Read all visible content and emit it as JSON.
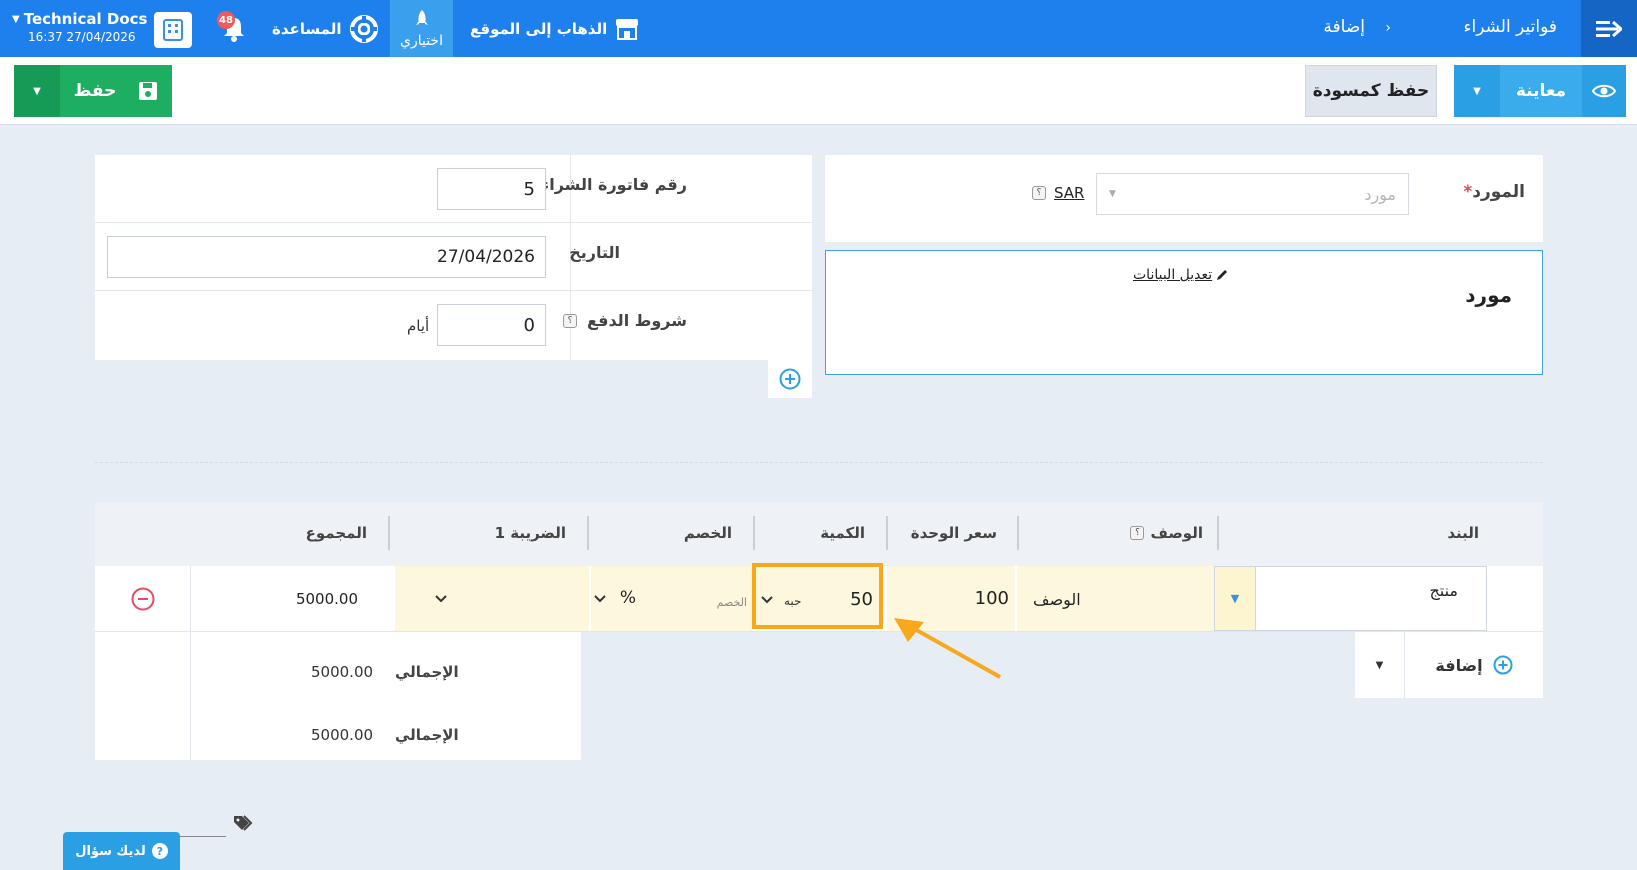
{
  "topbar": {
    "breadcrumb_root": "فواتير الشراء",
    "breadcrumb_current": "إضافة",
    "goto_site": "الذهاب إلى الموقع",
    "my_choice": "اختياري",
    "help": "المساعدة",
    "notifications_count": "48",
    "user_name": "Technical Docs",
    "datetime": "16:37 27/04/2026"
  },
  "actions": {
    "save": "حفظ",
    "save_draft": "حفظ كمسودة",
    "preview": "معاينة"
  },
  "supplier": {
    "label": "المورد",
    "required_mark": "*",
    "placeholder": "مورد",
    "currency": "SAR",
    "help": "؟",
    "card_title": "مورد",
    "edit_link": "تعديل البيانات"
  },
  "meta": {
    "invoice_number_label": "رقم فاتورة الشراء",
    "invoice_number": "5",
    "date_label": "التاريخ",
    "date": "27/04/2026",
    "payment_terms_label": "شروط الدفع",
    "payment_terms_help": "؟",
    "payment_terms_value": "0",
    "days_label": "أيام"
  },
  "items": {
    "headers": {
      "item": "البند",
      "description": "الوصف",
      "description_help": "؟",
      "unit_price": "سعر الوحدة",
      "quantity": "الكمية",
      "discount": "الخصم",
      "tax1": "الضريبة 1",
      "total": "المجموع"
    },
    "row": {
      "item": "منتج",
      "description": "الوصف",
      "unit_price": "100",
      "quantity": "50",
      "unit": "حبه",
      "discount_placeholder": "الخصم",
      "discount_type": "%",
      "total": "5000.00"
    },
    "add_label": "إضافة"
  },
  "totals": {
    "subtotal_label": "الإجمالي",
    "subtotal": "5000.00",
    "grand_label": "الإجمالي",
    "grand": "5000.00"
  },
  "help_widget": {
    "label": "لديك سؤال"
  },
  "colors": {
    "topbar": "#1d80ec",
    "save_green": "#1eae61",
    "preview_blue": "#3aacec",
    "highlight_orange": "#f7a81c"
  }
}
